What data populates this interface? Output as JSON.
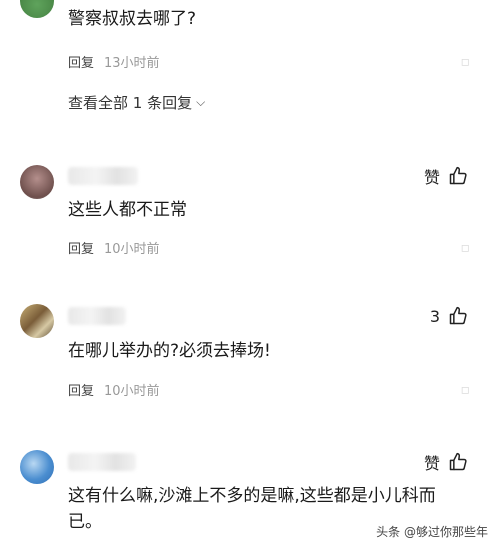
{
  "comments": [
    {
      "text": "警察叔叔去哪了?",
      "reply_label": "回复",
      "time": "13小时前",
      "view_all": "查看全部 1 条回复"
    },
    {
      "text": "这些人都不正常",
      "like_label": "赞",
      "reply_label": "回复",
      "time": "10小时前"
    },
    {
      "text": "在哪儿举办的?必须去捧场!",
      "like_count": "3",
      "reply_label": "回复",
      "time": "10小时前"
    },
    {
      "text": "这有什么嘛,沙滩上不多的是嘛,这些都是小儿科而已。",
      "like_label": "赞"
    }
  ],
  "watermark": "头条 @够过你那些年",
  "icons": {
    "thumb": "thumbs-up-icon",
    "chevron": "chevron-down-icon"
  }
}
